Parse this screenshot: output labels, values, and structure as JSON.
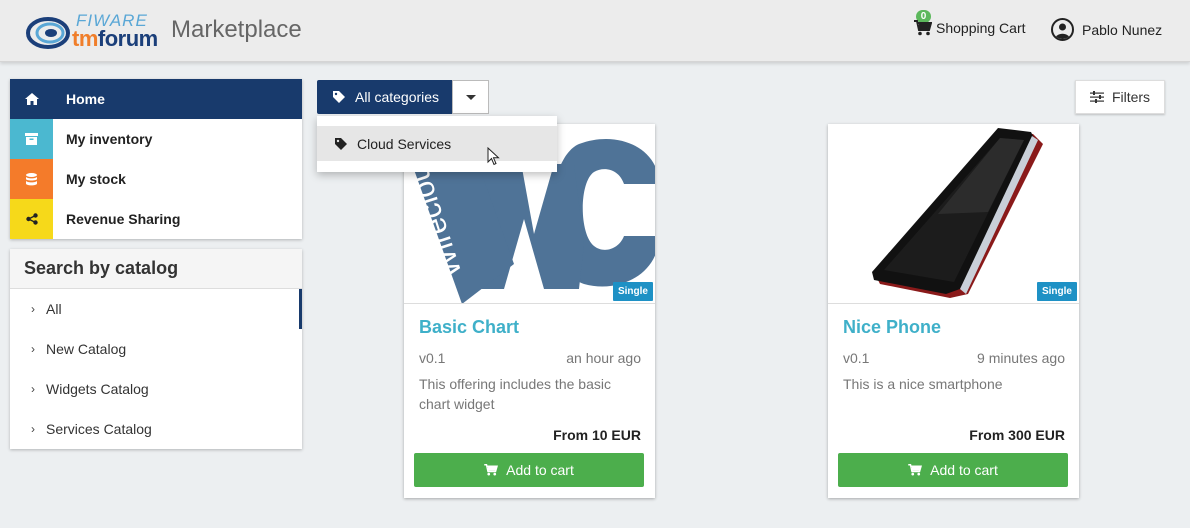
{
  "header": {
    "logo_top": "FIWARE",
    "logo_bottom_a": "tm",
    "logo_bottom_b": "forum",
    "title": "Marketplace",
    "cart_count": "0",
    "cart_label": "Shopping Cart",
    "user_name": "Pablo Nunez"
  },
  "nav": {
    "items": [
      {
        "label": "Home",
        "icon": "home-icon",
        "color": "#183a6c"
      },
      {
        "label": "My inventory",
        "icon": "archive-icon",
        "color": "#4bb8d0"
      },
      {
        "label": "My stock",
        "icon": "database-icon",
        "color": "#f47b2a"
      },
      {
        "label": "Revenue Sharing",
        "icon": "share-icon",
        "color": "#f6d91a"
      }
    ]
  },
  "catalog": {
    "heading": "Search by catalog",
    "items": [
      "All",
      "New Catalog",
      "Widgets Catalog",
      "Services Catalog"
    ]
  },
  "categories": {
    "button_label": "All categories",
    "menu_items": [
      "Cloud Services"
    ]
  },
  "filters_label": "Filters",
  "offerings": [
    {
      "title": "Basic Chart",
      "version": "v0.1",
      "time": "an hour ago",
      "description": "This offering includes the basic chart widget",
      "price": "From 10 EUR",
      "badge": "Single",
      "button": "Add to cart",
      "image_text": "Wirecloud"
    },
    {
      "title": "Nice Phone",
      "version": "v0.1",
      "time": "9 minutes ago",
      "description": "This is a nice smartphone",
      "price": "From 300 EUR",
      "badge": "Single",
      "button": "Add to cart"
    }
  ],
  "colors": {
    "primary": "#183a6c",
    "accent_title": "#3fb0c9",
    "success": "#4cae4c",
    "badge": "#1e91c5"
  }
}
